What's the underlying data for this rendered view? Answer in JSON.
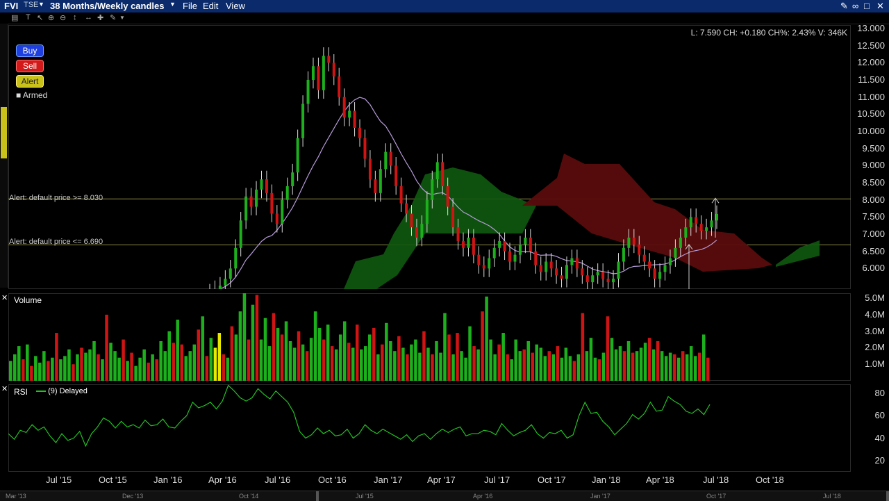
{
  "titlebar": {
    "symbol": "FVI",
    "exchange": "TSE",
    "period": "38 Months/Weekly candles",
    "menu": [
      "File",
      "Edit",
      "View"
    ]
  },
  "trade_buttons": {
    "buy": "Buy",
    "sell": "Sell",
    "alert": "Alert",
    "armed": "Armed"
  },
  "info_line": "L: 7.590 CH: +0.180 CH%: 2.43% V: 346K",
  "alerts": [
    "Alert: default price >= 8.030",
    "Alert: default price <= 6.690"
  ],
  "volume_panel": {
    "title": "Volume"
  },
  "rsi_panel": {
    "title": "RSI",
    "legend": "(9) Delayed"
  },
  "x_labels": [
    "Jul '15",
    "Oct '15",
    "Jan '16",
    "Apr '16",
    "Jul '16",
    "Oct '16",
    "Jan '17",
    "Apr '17",
    "Jul '17",
    "Oct '17",
    "Jan '18",
    "Apr '18",
    "Jul '18",
    "Oct '18"
  ],
  "scroll_labels": [
    "Mar '13",
    "Dec '13",
    "Oct '14",
    "Jul '15",
    "Apr '16",
    "Jan '17",
    "Oct '17",
    "Jul '18"
  ],
  "colors": {
    "up": "#1db01d",
    "down": "#d01414",
    "cloud_up": "#0f5a0f",
    "cloud_down": "#5a0c0c",
    "ma": "#b69bd9",
    "rsi": "#22c222",
    "alert_line": "#8a8a44"
  },
  "chart_data": [
    {
      "type": "candlestick",
      "title": "",
      "yticks": [
        "13.000",
        "12.500",
        "12.000",
        "11.500",
        "11.000",
        "10.500",
        "10.000",
        "9.500",
        "9.000",
        "8.500",
        "8.000",
        "7.500",
        "7.000",
        "6.500",
        "6.000"
      ],
      "ylim": [
        5.4,
        13.1
      ],
      "alert_levels": [
        8.03,
        6.69
      ],
      "closes": [
        5.3,
        5.4,
        5.5,
        5.7,
        6.0,
        6.6,
        7.4,
        8.1,
        7.8,
        8.3,
        8.6,
        8.2,
        7.6,
        7.3,
        8.0,
        8.4,
        8.8,
        9.8,
        10.8,
        11.5,
        11.9,
        11.2,
        12.2,
        12.0,
        11.6,
        11.0,
        10.4,
        10.6,
        10.1,
        9.8,
        9.2,
        8.6,
        8.2,
        8.9,
        9.4,
        9.0,
        8.4,
        7.9,
        7.6,
        7.2,
        6.9,
        7.3,
        8.0,
        8.6,
        9.1,
        8.4,
        7.8,
        7.2,
        6.8,
        6.6,
        6.9,
        6.4,
        6.1,
        6.0,
        6.3,
        6.6,
        6.8,
        6.5,
        6.2,
        6.4,
        6.7,
        6.9,
        6.5,
        6.1,
        5.9,
        6.2,
        6.0,
        5.8,
        5.7,
        6.1,
        6.3,
        6.0,
        5.8,
        5.6,
        5.8,
        5.9,
        5.7,
        5.6,
        5.7,
        6.2,
        6.6,
        6.9,
        6.7,
        6.4,
        6.2,
        6.0,
        5.7,
        5.9,
        6.1,
        6.3,
        6.6,
        6.9,
        7.2,
        7.5,
        7.3,
        7.1,
        7.2,
        7.4,
        7.59
      ],
      "moving_average": "purple line",
      "cloud": "ichimoku-style green/red cloud"
    },
    {
      "type": "bar",
      "title": "Volume",
      "yticks": [
        "5.0M",
        "4.0M",
        "3.0M",
        "2.0M",
        "1.0M"
      ],
      "ylim": [
        0,
        5.3
      ],
      "values": [
        1.2,
        1.6,
        2.1,
        1.3,
        2.2,
        0.9,
        1.5,
        1.1,
        1.8,
        1.2,
        1.4,
        2.9,
        1.3,
        1.5,
        1.9,
        1.0,
        1.6,
        2.0,
        1.7,
        1.9,
        2.4,
        1.6,
        1.3,
        4.0,
        2.3,
        1.8,
        1.4,
        2.5,
        1.2,
        1.7,
        0.9,
        1.4,
        1.9,
        1.1,
        1.6,
        1.3,
        2.4,
        1.8,
        3.0,
        2.3,
        3.7,
        2.2,
        1.5,
        1.8,
        2.2,
        3.1,
        3.9,
        1.5,
        2.6,
        2.0,
        2.9,
        1.6,
        1.4,
        3.3,
        2.8,
        4.2,
        5.3,
        2.5,
        4.6,
        5.2,
        2.5,
        3.8,
        2.1,
        4.1,
        3.2,
        2.8,
        3.6,
        2.4,
        2.0,
        3.0,
        2.2,
        1.8,
        2.6,
        4.2,
        3.2,
        2.5,
        3.4,
        2.1,
        1.9,
        2.8,
        3.6,
        2.3,
        2.0,
        3.4,
        1.9,
        2.1,
        2.8,
        3.2,
        1.6,
        2.2,
        3.5,
        2.4,
        1.8,
        2.7,
        2.0,
        1.6,
        2.2,
        2.5,
        1.7,
        3.0,
        2.0,
        1.6,
        2.4,
        1.7,
        4.1,
        2.8,
        1.6,
        2.9,
        1.8,
        1.4,
        3.3,
        2.1,
        1.9,
        4.2,
        5.1,
        2.5,
        1.6,
        2.2,
        2.9,
        1.6,
        1.3,
        2.5,
        1.8,
        1.9,
        2.4,
        1.7,
        2.2,
        2.0,
        1.5,
        1.8,
        1.6,
        2.1,
        1.4,
        2.0,
        1.5,
        1.2,
        1.6,
        4.1,
        1.8,
        2.6,
        1.4,
        1.3,
        1.7,
        3.9,
        2.6,
        1.9,
        2.1,
        1.8,
        2.4,
        1.7,
        1.8,
        2.0,
        2.3,
        2.6,
        1.9,
        2.4,
        1.8,
        1.5,
        1.7,
        1.6,
        1.4,
        1.8,
        1.6,
        2.1,
        1.5,
        1.7,
        2.8,
        1.4
      ],
      "up_pattern": "alternating red/green bars"
    },
    {
      "type": "line",
      "title": "RSI",
      "yticks": [
        "80",
        "60",
        "40",
        "20"
      ],
      "ylim": [
        10,
        88
      ],
      "values": [
        44,
        39,
        47,
        45,
        52,
        47,
        50,
        42,
        36,
        44,
        38,
        40,
        46,
        33,
        44,
        50,
        58,
        55,
        49,
        55,
        50,
        52,
        49,
        56,
        51,
        52,
        57,
        50,
        49,
        55,
        60,
        72,
        67,
        69,
        72,
        66,
        73,
        87,
        82,
        76,
        73,
        76,
        84,
        79,
        75,
        82,
        77,
        72,
        63,
        46,
        40,
        43,
        49,
        44,
        47,
        42,
        43,
        48,
        40,
        44,
        52,
        47,
        44,
        48,
        45,
        42,
        39,
        43,
        37,
        42,
        44,
        39,
        44,
        48,
        45,
        48,
        50,
        42,
        44,
        44,
        47,
        46,
        43,
        53,
        47,
        42,
        45,
        47,
        52,
        44,
        40,
        45,
        44,
        47,
        40,
        43,
        60,
        72,
        62,
        63,
        55,
        50,
        43,
        48,
        53,
        61,
        57,
        62,
        72,
        64,
        65,
        77,
        73,
        70,
        64,
        62,
        66,
        61,
        70
      ],
      "note": "RSI line"
    }
  ]
}
